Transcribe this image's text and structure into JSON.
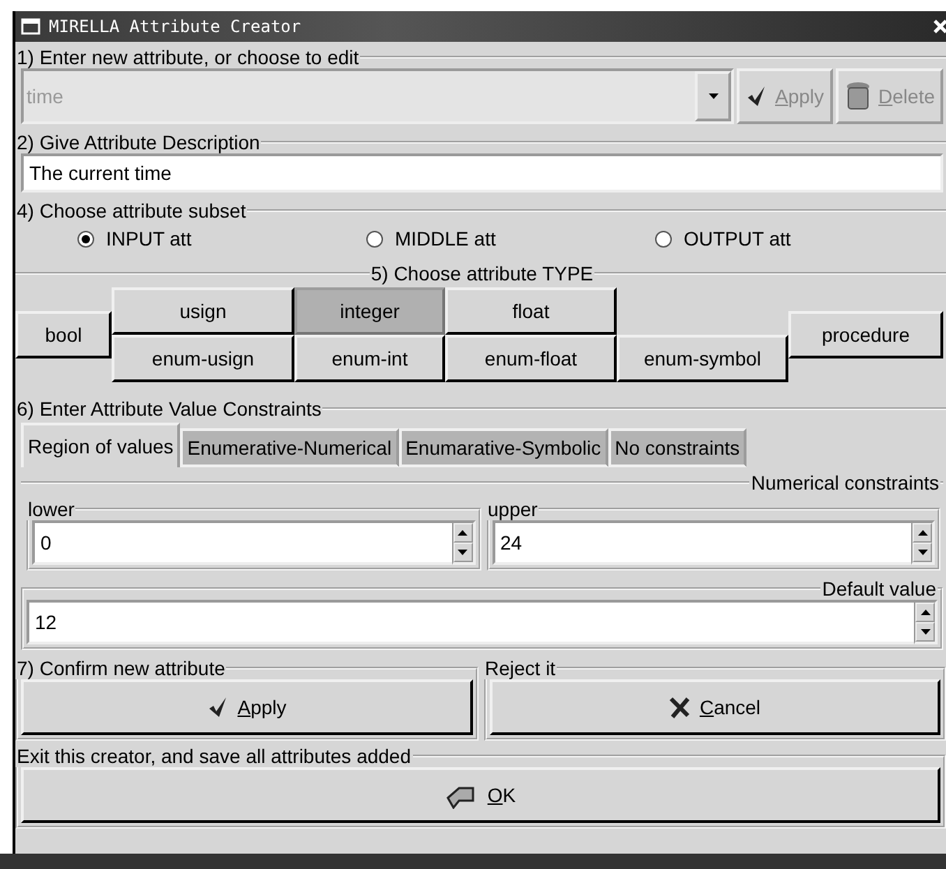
{
  "window": {
    "title": "MIRELLA Attribute Creator"
  },
  "section_1": {
    "legend": "1)  Enter new attribute, or choose to edit",
    "combo": {
      "value": "time",
      "disabled": true
    },
    "buttons": [
      {
        "label": "Apply",
        "disabled": true
      },
      {
        "label": "Delete",
        "disabled": true
      }
    ]
  },
  "section_2": {
    "legend": "2)  Give Attribute Description",
    "value": "The current time"
  },
  "section_4": {
    "legend": "4)  Choose attribute subset",
    "options": [
      {
        "label": "INPUT att",
        "selected": true
      },
      {
        "label": "MIDDLE att",
        "selected": false
      },
      {
        "label": "OUTPUT att",
        "selected": false
      }
    ]
  },
  "section_5": {
    "legend": "5)  Choose attribute TYPE",
    "types": [
      {
        "label": "bool",
        "kind": "tall",
        "selected": false
      },
      {
        "label": "usign",
        "kind": "upper",
        "selected": false
      },
      {
        "label": "integer",
        "kind": "upper",
        "selected": true
      },
      {
        "label": "float",
        "kind": "upper",
        "selected": false
      },
      {
        "label": "enum-usign",
        "kind": "lower",
        "selected": false
      },
      {
        "label": "enum-int",
        "kind": "lower",
        "selected": false
      },
      {
        "label": "enum-float",
        "kind": "lower",
        "selected": false
      },
      {
        "label": "enum-symbol",
        "kind": "lower",
        "selected": false
      },
      {
        "label": "procedure",
        "kind": "tall",
        "selected": false
      }
    ]
  },
  "section_6": {
    "legend": "6)  Enter Attribute Value Constraints",
    "tabs": [
      {
        "label": "Region of values",
        "selected": true
      },
      {
        "label": "Enumerative-Numerical",
        "selected": false
      },
      {
        "label": "Enumarative-Symbolic",
        "selected": false
      },
      {
        "label": "No constraints",
        "selected": false
      }
    ],
    "numerical_legend": "Numerical constraints",
    "lower": {
      "legend": "lower",
      "value": "0"
    },
    "upper": {
      "legend": "upper",
      "value": "24"
    },
    "default": {
      "legend": "Default value",
      "value": "12"
    }
  },
  "section_7": {
    "legend": "7) Confirm new attribute",
    "button": {
      "label": "Apply"
    }
  },
  "reject": {
    "legend": "Reject it",
    "button": {
      "label": "Cancel"
    }
  },
  "exit": {
    "legend": "Exit this creator, and save all attributes added",
    "button": {
      "label": "OK"
    }
  }
}
